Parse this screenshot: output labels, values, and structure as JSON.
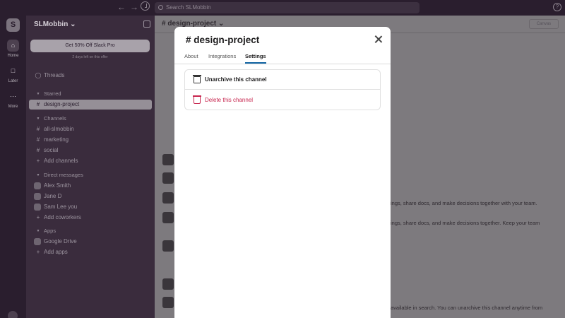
{
  "topbar": {
    "back_icon": "arrow-left-icon",
    "forward_icon": "arrow-right-icon",
    "history_icon": "clock-icon",
    "search_placeholder": "Search SLMobbin",
    "help_label": "?"
  },
  "rail": {
    "workspace_initial": "S",
    "items": [
      {
        "label": "Home",
        "icon": "home-icon"
      },
      {
        "label": "Later",
        "icon": "bookmark-icon"
      },
      {
        "label": "More",
        "icon": "more-icon"
      }
    ]
  },
  "sidebar": {
    "workspace_name": "SLMobbin",
    "promo_label": "Get 50% Off Slack Pro",
    "promo_sub": "2 days left on this offer",
    "threads": "Threads",
    "starred_header": "Starred",
    "starred_items": [
      "design-project"
    ],
    "channels_header": "Channels",
    "channels": [
      "all-slmobbin",
      "marketing",
      "social"
    ],
    "add_channels": "Add channels",
    "dm_header": "Direct messages",
    "dms": [
      "Alex Smith",
      "Jane D",
      "Sam Lee  you"
    ],
    "add_coworkers": "Add coworkers",
    "apps_header": "Apps",
    "apps": [
      "Google Drive"
    ],
    "add_apps": "Add apps"
  },
  "main": {
    "channel_title": "# design-project",
    "canvas_button": "Canvas",
    "texts": [
      "ings, share docs, and make decisions together with your team.",
      "ings, share docs, and make decisions together. Keep your team",
      "available in search. You can unarchive this channel anytime from"
    ]
  },
  "modal": {
    "title": "# design-project",
    "tabs": [
      "About",
      "Integrations",
      "Settings"
    ],
    "active_tab": "Settings",
    "actions": {
      "unarchive": "Unarchive this channel",
      "delete": "Delete this channel"
    },
    "colors": {
      "danger": "#c7254e",
      "tab_underline": "#1264a3"
    }
  }
}
